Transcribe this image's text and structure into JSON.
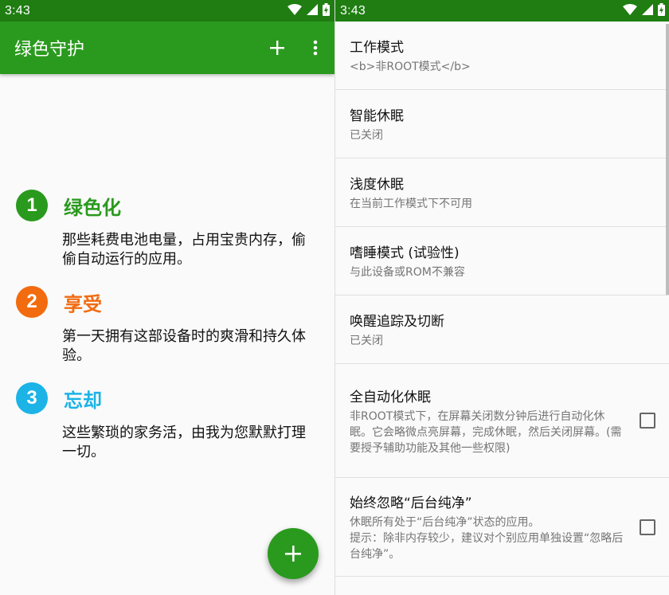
{
  "status_bar": {
    "time_left": "3:43",
    "time_right": "3:43"
  },
  "app": {
    "title": "绿色守护"
  },
  "steps": [
    {
      "number": "1",
      "heading": "绿色化",
      "color": "#2a9a1e",
      "desc": "那些耗费电池电量，占用宝贵内存，偷偷自动运行的应用。"
    },
    {
      "number": "2",
      "heading": "享受",
      "color": "#f26b0f",
      "desc": "第一天拥有这部设备时的爽滑和持久体验。"
    },
    {
      "number": "3",
      "heading": "忘却",
      "color": "#1cb3e6",
      "desc": "这些繁琐的家务活，由我为您默默打理一切。"
    }
  ],
  "settings": [
    {
      "title": "工作模式",
      "summary": "<b>非ROOT模式</b>"
    },
    {
      "title": "智能休眠",
      "summary": "已关闭"
    },
    {
      "title": "浅度休眠",
      "summary": "在当前工作模式下不可用"
    },
    {
      "title": "嗜睡模式 (试验性)",
      "summary": "与此设备或ROM不兼容"
    },
    {
      "title": "唤醒追踪及切断",
      "summary": "已关闭"
    },
    {
      "title": "全自动化休眠",
      "summary": "非ROOT模式下，在屏幕关闭数分钟后进行自动化休眠。它会略微点亮屏幕，完成休眠，然后关闭屏幕。(需要授予辅助功能及其他一些权限)",
      "checked": false
    },
    {
      "title": "始终忽略“后台纯净”",
      "summary": "休眠所有处于“后台纯净”状态的应用。\n提示：除非内存较少，建议对个别应用单独设置“忽略后台纯净”。",
      "checked": false
    }
  ],
  "colors": {
    "status_bar": "#1f7d12",
    "app_bar": "#2a9a1e",
    "fab": "#2a9a1e"
  }
}
